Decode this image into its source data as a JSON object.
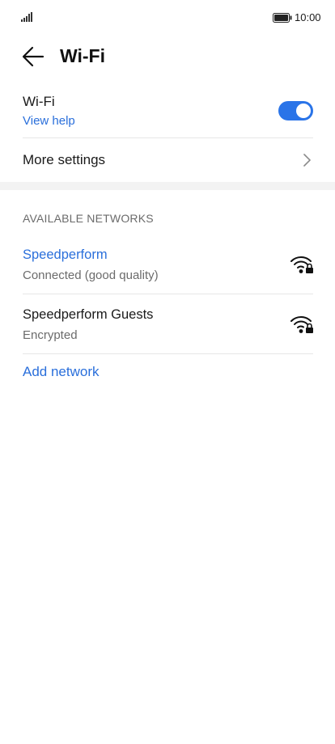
{
  "status_bar": {
    "time": "10:00",
    "signal_icon": "signal-icon",
    "battery_icon": "battery-icon"
  },
  "header": {
    "back_icon": "back-arrow-icon",
    "title": "Wi-Fi"
  },
  "wifi_toggle_row": {
    "label": "Wi-Fi",
    "help_link": "View help",
    "toggle_on": true,
    "accent_color": "#2a74e8"
  },
  "more_settings": {
    "label": "More settings",
    "chevron_icon": "chevron-right-icon"
  },
  "available_networks": {
    "header": "AVAILABLE NETWORKS",
    "networks": [
      {
        "name": "Speedperform",
        "status": "Connected (good quality)",
        "connected": true,
        "icon": "wifi-locked-icon"
      },
      {
        "name": "Speedperform Guests",
        "status": "Encrypted",
        "connected": false,
        "icon": "wifi-locked-icon"
      }
    ],
    "add_network": "Add network"
  },
  "colors": {
    "link": "#2a6fdb",
    "secondary_text": "#6b6b6b"
  }
}
